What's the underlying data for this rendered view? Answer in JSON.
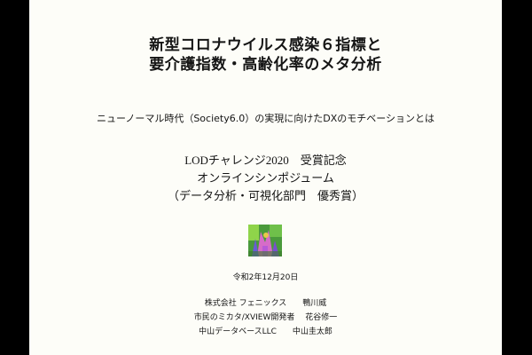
{
  "slide": {
    "title_lines": [
      "新型コロナウイルス感染６指標と",
      "要介護指数・高齢化率のメタ分析"
    ],
    "subtitle": "ニューノーマル時代（Society6.0）の実現に向けたDXのモチベーションとは",
    "award_lines": [
      "LODチャレンジ2020　受賞記念",
      "オンラインシンポジューム",
      "（データ分析・可視化部門　優秀賞）"
    ],
    "date": "令和2年12月20日",
    "authors": [
      "株式会社 フェニックス　　鴨川威",
      "市民のミカタ/XVIEW開発者　 花谷修一",
      "中山データベースLLC　　中山圭太郎"
    ]
  },
  "logo": {
    "icon": "colorful-abstract-logo-icon",
    "colors": [
      "#4a9a3c",
      "#8fd44a",
      "#d66cc8",
      "#6a5ad8",
      "#e8c84a"
    ]
  },
  "colors": {
    "background": "#000000",
    "slide": "#fdfdf8",
    "text": "#151515"
  }
}
